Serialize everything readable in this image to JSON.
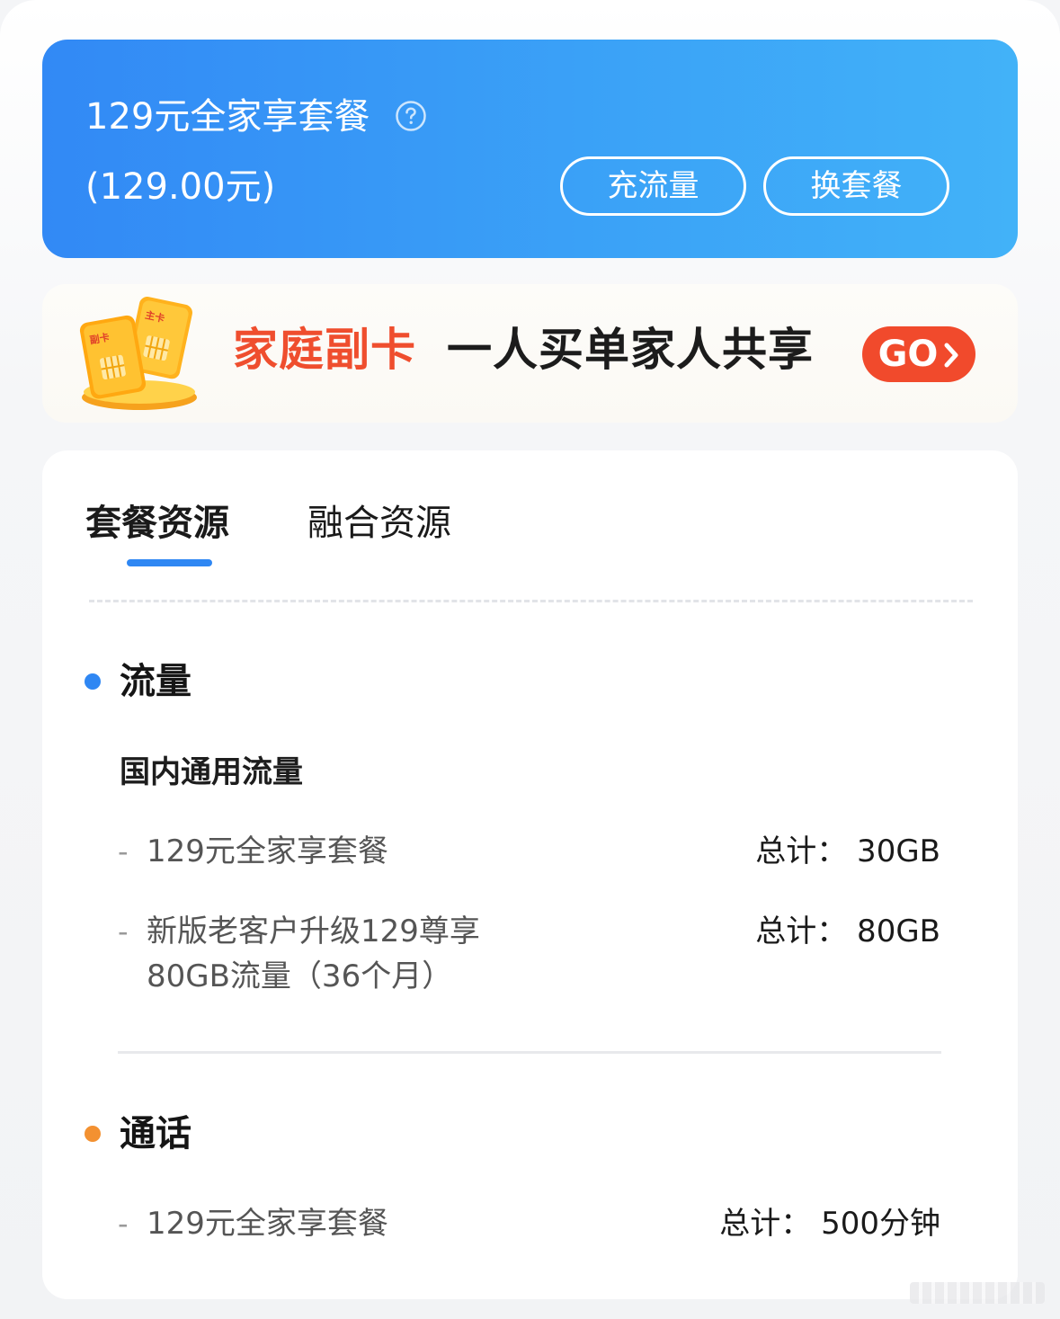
{
  "plan": {
    "title": "129元全家享套餐",
    "price": "(129.00元)",
    "recharge_label": "充流量",
    "change_label": "换套餐"
  },
  "banner": {
    "highlight": "家庭副卡",
    "slogan": "一人买单家人共享",
    "go_label": "GO",
    "art_tag_primary": "主卡",
    "art_tag_secondary": "副卡"
  },
  "tabs": {
    "package": "套餐资源",
    "fusion": "融合资源"
  },
  "data_section": {
    "title": "流量",
    "dot_color": "#2f87f3",
    "subtitle": "国内通用流量",
    "items": [
      {
        "name": "129元全家享套餐",
        "total": "总计：  30GB"
      },
      {
        "name_line1": "新版老客户升级129尊享",
        "name_line2": "80GB流量（36个月）",
        "total": "总计：  80GB"
      }
    ]
  },
  "call_section": {
    "title": "通话",
    "dot_color": "#f39131",
    "items": [
      {
        "name": "129元全家享套餐",
        "total": "总计：  500分钟"
      }
    ]
  },
  "colors": {
    "brand_blue": "#3289f5",
    "banner_red": "#ef4e2e",
    "go_red": "#f14a2c"
  },
  "icons": [
    "help-icon",
    "sim-card-icon",
    "chevron-right-icon"
  ]
}
